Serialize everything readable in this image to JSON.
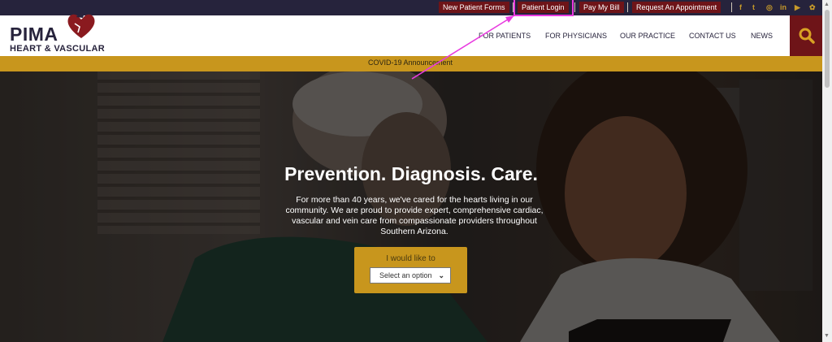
{
  "topbar": {
    "links": [
      "New Patient Forms",
      "Patient Login",
      "Pay My Bill",
      "Request An Appointment"
    ],
    "social": [
      "f",
      "t",
      "◎",
      "in",
      "▶",
      "✿"
    ]
  },
  "header": {
    "logo_word": "PIMA",
    "logo_sub": "HEART & VASCULAR",
    "nav": [
      "FOR PATIENTS",
      "FOR PHYSICIANS",
      "OUR PRACTICE",
      "CONTACT US",
      "NEWS"
    ]
  },
  "announcement": {
    "text": "COVID-19 Announcement"
  },
  "hero": {
    "title": "Prevention. Diagnosis. Care.",
    "text": "For more than 40 years, we've cared for the hearts living in our community. We are proud to provide expert, comprehensive cardiac, vascular and vein care from compassionate providers throughout Southern Arizona.",
    "select_label": "I would like to",
    "select_value": "Select an option"
  },
  "colors": {
    "navy": "#26233c",
    "maroon": "#6e1418",
    "gold": "#c8961d",
    "annotation": "#e83adf"
  },
  "icons": [
    "search-icon",
    "heart-logo-icon",
    "chevron-down-icon"
  ]
}
